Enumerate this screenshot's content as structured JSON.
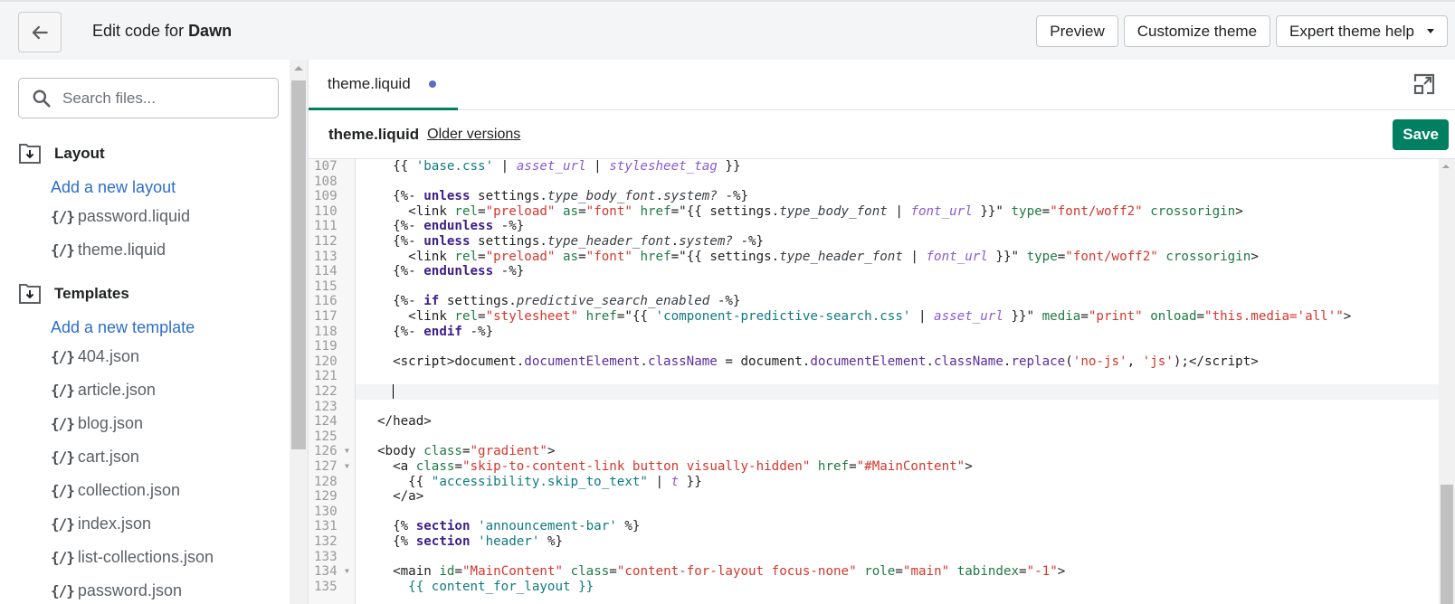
{
  "topbar": {
    "back_icon": "arrow-left-icon",
    "title_prefix": "Edit code for ",
    "theme_name": "Dawn",
    "actions": {
      "preview": "Preview",
      "customize": "Customize theme",
      "help": "Expert theme help"
    }
  },
  "sidebar": {
    "search_placeholder": "Search files...",
    "sections": [
      {
        "title": "Layout",
        "add_label": "Add a new layout",
        "files": [
          "password.liquid",
          "theme.liquid"
        ]
      },
      {
        "title": "Templates",
        "add_label": "Add a new template",
        "files": [
          "404.json",
          "article.json",
          "blog.json",
          "cart.json",
          "collection.json",
          "index.json",
          "list-collections.json",
          "password.json"
        ]
      }
    ],
    "file_icon_glyph": "{/}"
  },
  "editor": {
    "tab_label": "theme.liquid",
    "tab_unsaved": true,
    "file_name": "theme.liquid",
    "older_versions": "Older versions",
    "save_label": "Save",
    "accent_color": "#008060",
    "active_line": 122,
    "lines": [
      {
        "n": 107,
        "fold": false,
        "html": "  <span class=\"pl\">{{ </span><span class=\"tstr\">'base.css'</span><span class=\"pl\"> | </span><span class=\"fn\">asset_url</span><span class=\"pl\"> | </span><span class=\"fn\">stylesheet_tag</span><span class=\"pl\"> }}</span>"
      },
      {
        "n": 108,
        "fold": false,
        "html": ""
      },
      {
        "n": 109,
        "fold": false,
        "html": "  {%- <span class=\"kw\">unless</span> settings.<span class=\"var\">type_body_font</span>.<span class=\"var\">system?</span> -%}"
      },
      {
        "n": 110,
        "fold": false,
        "html": "    &lt;link <span class=\"attr\">rel</span>=<span class=\"str\">\"preload\"</span> <span class=\"attr\">as</span>=<span class=\"str\">\"font\"</span> <span class=\"attr\">href</span>=\"{{ settings.<span class=\"var\">type_body_font</span> | <span class=\"fn\">font_url</span> }}\" <span class=\"attr\">type</span>=<span class=\"str\">\"font/woff2\"</span> <span class=\"attr\">crossorigin</span>&gt;"
      },
      {
        "n": 111,
        "fold": false,
        "html": "  {%- <span class=\"kw\">endunless</span> -%}"
      },
      {
        "n": 112,
        "fold": false,
        "html": "  {%- <span class=\"kw\">unless</span> settings.<span class=\"var\">type_header_font</span>.<span class=\"var\">system?</span> -%}"
      },
      {
        "n": 113,
        "fold": false,
        "html": "    &lt;link <span class=\"attr\">rel</span>=<span class=\"str\">\"preload\"</span> <span class=\"attr\">as</span>=<span class=\"str\">\"font\"</span> <span class=\"attr\">href</span>=\"{{ settings.<span class=\"var\">type_header_font</span> | <span class=\"fn\">font_url</span> }}\" <span class=\"attr\">type</span>=<span class=\"str\">\"font/woff2\"</span> <span class=\"attr\">crossorigin</span>&gt;"
      },
      {
        "n": 114,
        "fold": false,
        "html": "  {%- <span class=\"kw\">endunless</span> -%}"
      },
      {
        "n": 115,
        "fold": false,
        "html": ""
      },
      {
        "n": 116,
        "fold": false,
        "html": "  {%- <span class=\"kw\">if</span> settings.<span class=\"var\">predictive_search_enabled</span> -%}"
      },
      {
        "n": 117,
        "fold": false,
        "html": "    &lt;link <span class=\"attr\">rel</span>=<span class=\"str\">\"stylesheet\"</span> <span class=\"attr\">href</span>=\"{{ <span class=\"tstr\">'component-predictive-search.css'</span> | <span class=\"fn\">asset_url</span> }}\" <span class=\"attr\">media</span>=<span class=\"str\">\"print\"</span> <span class=\"attr\">onload</span>=<span class=\"str\">\"this.media='all'\"</span>&gt;"
      },
      {
        "n": 118,
        "fold": false,
        "html": "  {%- <span class=\"kw\">endif</span> -%}"
      },
      {
        "n": 119,
        "fold": false,
        "html": ""
      },
      {
        "n": 120,
        "fold": false,
        "html": "  &lt;script&gt;document.<span class=\"prop\">documentElement</span>.<span class=\"prop\">className</span> = document.<span class=\"prop\">documentElement</span>.<span class=\"prop\">className</span>.<span class=\"prop\">replace</span>(<span class=\"str\">'no-js'</span>, <span class=\"str\">'js'</span>);&lt;/script&gt;"
      },
      {
        "n": 121,
        "fold": false,
        "html": ""
      },
      {
        "n": 122,
        "fold": false,
        "html": ""
      },
      {
        "n": 123,
        "fold": false,
        "html": ""
      },
      {
        "n": 124,
        "fold": false,
        "html": "&lt;/head&gt;"
      },
      {
        "n": 125,
        "fold": false,
        "html": ""
      },
      {
        "n": 126,
        "fold": true,
        "html": "&lt;body <span class=\"attr\">class</span>=<span class=\"str\">\"gradient\"</span>&gt;"
      },
      {
        "n": 127,
        "fold": true,
        "html": "  &lt;a <span class=\"attr\">class</span>=<span class=\"str\">\"skip-to-content-link button visually-hidden\"</span> <span class=\"attr\">href</span>=<span class=\"str\">\"#MainContent\"</span>&gt;"
      },
      {
        "n": 128,
        "fold": false,
        "html": "    {{ <span class=\"tstr\">\"accessibility.skip_to_text\"</span> | <span class=\"fn\">t</span> }}"
      },
      {
        "n": 129,
        "fold": false,
        "html": "  &lt;/a&gt;"
      },
      {
        "n": 130,
        "fold": false,
        "html": ""
      },
      {
        "n": 131,
        "fold": false,
        "html": "  {% <span class=\"kw\">section</span> <span class=\"tstr\">'announcement-bar'</span> %}"
      },
      {
        "n": 132,
        "fold": false,
        "html": "  {% <span class=\"kw\">section</span> <span class=\"tstr\">'header'</span> %}"
      },
      {
        "n": 133,
        "fold": false,
        "html": ""
      },
      {
        "n": 134,
        "fold": true,
        "html": "  &lt;main <span class=\"attr\">id</span>=<span class=\"str\">\"MainContent\"</span> <span class=\"attr\">class</span>=<span class=\"str\">\"content-for-layout focus-none\"</span> <span class=\"attr\">role</span>=<span class=\"str\">\"main\"</span> <span class=\"attr\">tabindex</span>=<span class=\"str\">\"-1\"</span>&gt;"
      },
      {
        "n": 135,
        "fold": false,
        "html": "    <span class=\"tstr\">{{ content_for_layout }}</span>"
      }
    ]
  }
}
